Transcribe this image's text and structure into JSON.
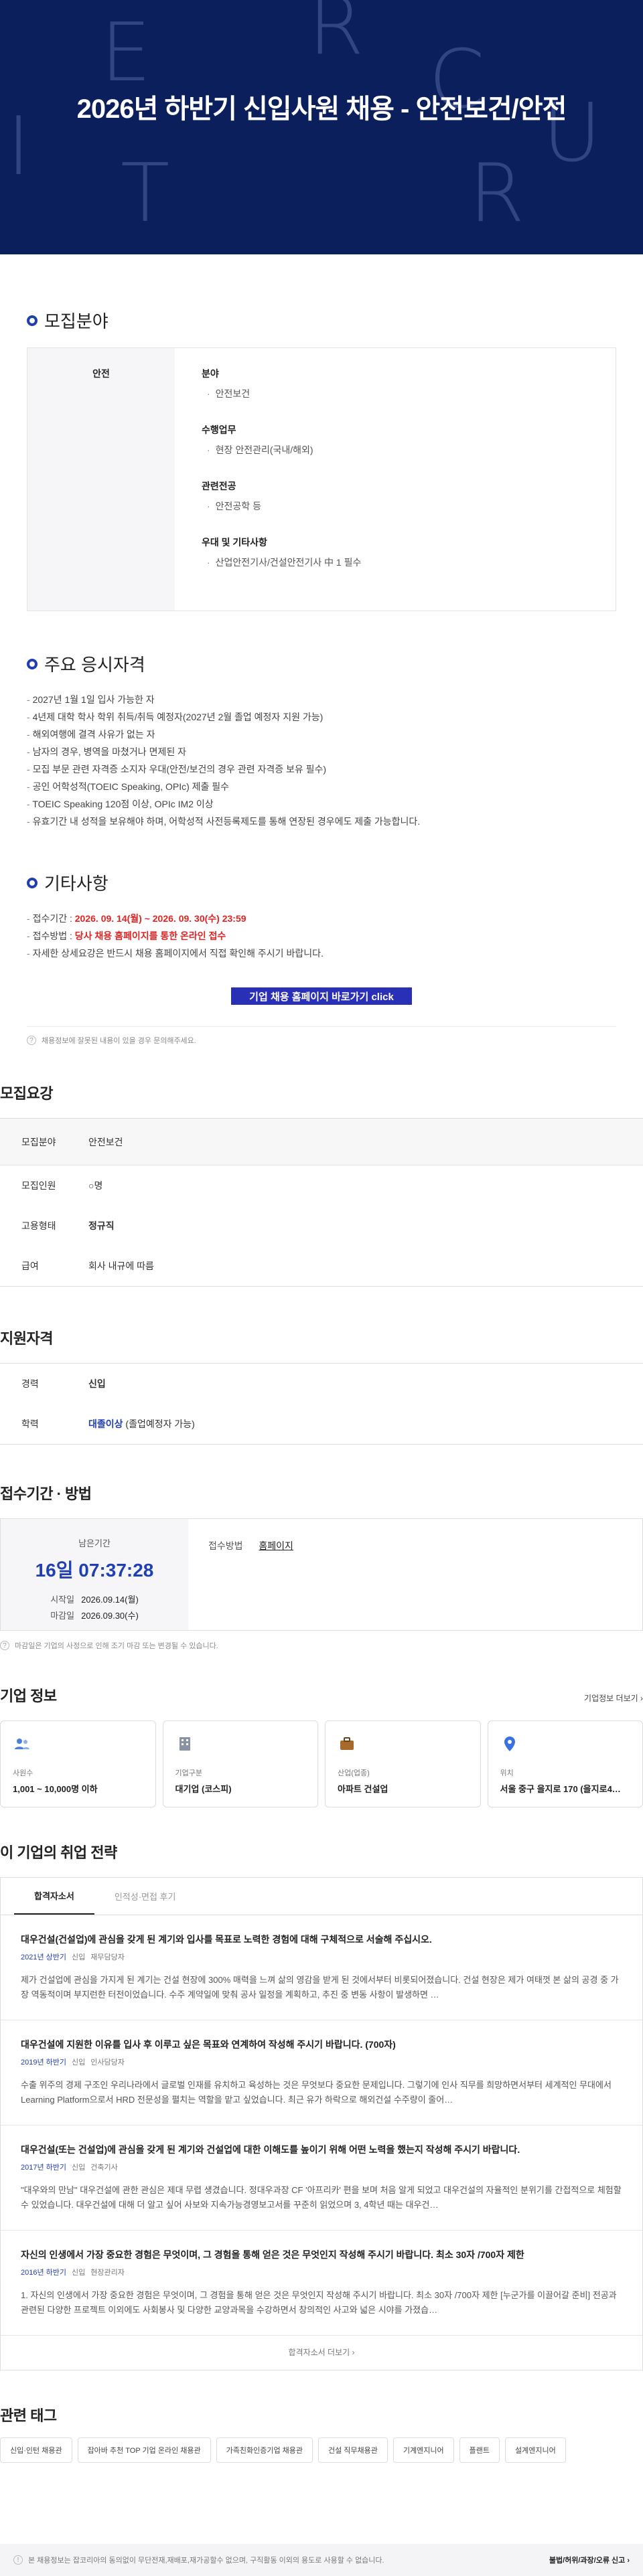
{
  "hero": {
    "title": "2026년 하반기 신입사원 채용 - 안전보건/안전",
    "deco_letters": [
      "R",
      "E",
      "C",
      "U",
      "I",
      "T",
      "R"
    ]
  },
  "recruit_field": {
    "heading": "모집분야",
    "category": "안전",
    "blocks": [
      {
        "title": "분야",
        "value": "안전보건"
      },
      {
        "title": "수행업무",
        "value": "현장 안전관리(국내/해외)"
      },
      {
        "title": "관련전공",
        "value": "안전공학 등"
      },
      {
        "title": "우대 및 기타사항",
        "value": "산업안전기사/건설안전기사 中 1 필수"
      }
    ]
  },
  "qualifications": {
    "heading": "주요 응시자격",
    "items": [
      "2027년 1월 1일 입사 가능한 자",
      "4년제 대학 학사 학위 취득/취득 예정자(2027년 2월 졸업 예정자 지원 가능)",
      "해외여행에 결격 사유가 없는 자",
      "남자의 경우, 병역을 마쳤거나 면제된 자",
      "모집 부문 관련 자격증 소지자 우대(안전/보건의 경우 관련 자격증 보유 필수)",
      "공인 어학성적(TOEIC Speaking, OPIc) 제출 필수",
      "TOEIC Speaking 120점 이상, OPIc IM2 이상",
      "유효기간 내 성적을 보유해야 하며, 어학성적 사전등록제도를 통해 연장된 경우에도 제출 가능합니다."
    ]
  },
  "etc": {
    "heading": "기타사항",
    "period_label": "접수기간 : ",
    "period_value": "2026. 09. 14(월) ~ 2026. 09. 30(수) 23:59",
    "method_label": "접수방법 : ",
    "method_value": "당사 채용 홈페이지를 통한 온라인 접수",
    "detail": "자세한 상세요강은 반드시 채용 홈페이지에서 직접 확인해 주시기 바랍니다.",
    "cta": "기업 채용 홈페이지 바로가기 click"
  },
  "notice1": "채용정보에 잘못된 내용이 있을 경우 문의해주세요.",
  "summary": {
    "heading": "모집요강",
    "rows": [
      {
        "k": "모집분야",
        "v": "안전보건"
      },
      {
        "k": "모집인원",
        "v": "○명"
      },
      {
        "k": "고용형태",
        "v": "정규직"
      },
      {
        "k": "급여",
        "v": "회사 내규에 따름"
      }
    ]
  },
  "eligibility": {
    "heading": "지원자격",
    "career_label": "경력",
    "career_value": "신입",
    "edu_label": "학력",
    "edu_value": "대졸이상",
    "edu_note": " (졸업예정자 가능)"
  },
  "apply": {
    "heading": "접수기간 · 방법",
    "remain_label": "남은기간",
    "remain_time": "16일 07:37:28",
    "start_label": "시작일",
    "start_value": "2026.09.14(월)",
    "end_label": "마감일",
    "end_value": "2026.09.30(수)",
    "method_label": "접수방법",
    "method_value": "홈페이지",
    "notice": "마감일은 기업의 사정으로 인해 조기 마감 또는 변경될 수 있습니다."
  },
  "company": {
    "heading": "기업 정보",
    "more": "기업정보 더보기 ›",
    "cards": [
      {
        "label": "사원수",
        "value": "1,001 ~ 10,000명 이하",
        "icon": "people-icon",
        "color": "#4a7fe0"
      },
      {
        "label": "기업구분",
        "value": "대기업 (코스피)",
        "icon": "building-icon",
        "color": "#8a93a6"
      },
      {
        "label": "산업(업종)",
        "value": "아파트 건설업",
        "icon": "briefcase-icon",
        "color": "#a86a2b"
      },
      {
        "label": "위치",
        "value": "서울 중구 을지로 170 (을지로4…",
        "icon": "pin-icon",
        "color": "#3a72e0"
      }
    ]
  },
  "strategy": {
    "heading": "이 기업의 취업 전략",
    "tabs": [
      "합격자소서",
      "인적성·면접 후기"
    ],
    "items": [
      {
        "q": "대우건설(건설업)에 관심을 갖게 된 계기와 입사를 목표로 노력한 경험에 대해 구체적으로 서술해 주십시오.",
        "year": "2021년 상반기",
        "type": "신입",
        "job": "재무담당자",
        "a": "제가 건설업에 관심을 가지게 된 계기는 건설 현장에 300% 매력을 느껴 삶의 영감을 받게 된 것에서부터 비롯되어졌습니다. 건설 현장은 제가 여태껏 본 삶의 공경 중 가장 역동적이며 부지런한 터전이었습니다. 수주 계약일에 맞춰 공사 일정을 계획하고, 추진 중 변동 사항이 발생하면 …"
      },
      {
        "q": "대우건설에 지원한 이유를 입사 후 이루고 싶은 목표와 연계하여 작성해 주시기 바랍니다. (700자)",
        "year": "2019년 하반기",
        "type": "신입",
        "job": "인사담당자",
        "a": "수출 위주의 경제 구조인 우리나라에서 글로벌 인재를 유치하고 육성하는 것은 무엇보다 중요한 문제입니다. 그렇기에 인사 직무를 희망하면서부터 세계적인 무대에서 Learning Platform으로서 HRD 전문성을 펼치는 역할을 맡고 싶었습니다. 최근 유가 하락으로 해외건설 수주량이 줄어…"
      },
      {
        "q": "대우건설(또는 건설업)에 관심을 갖게 된 계기와 건설업에 대한 이해도를 높이기 위해 어떤 노력을 했는지 작성해 주시기 바랍니다.",
        "year": "2017년 하반기",
        "type": "신입",
        "job": "건축기사",
        "a": "\"대우와의 만남\" 대우건설에 관한 관심은 제대 무렵 생겼습니다. 정대우과장 CF '아프리카' 편을 보며 처음 알게 되었고 대우건설의 자율적인 분위기를 간접적으로 체험할 수 있었습니다. 대우건설에 대해 더 알고 싶어 사보와 지속가능경영보고서를 꾸준히 읽었으며 3, 4학년 때는 대우건…"
      },
      {
        "q": "자신의 인생에서 가장 중요한 경험은 무엇이며, 그 경험을 통해 얻은 것은 무엇인지 작성해 주시기 바랍니다. 최소 30자 /700자 제한",
        "year": "2016년 하반기",
        "type": "신입",
        "job": "현장관리자",
        "a": "1. 자신의 인생에서 가장 중요한 경험은 무엇이며, 그 경험을 통해 얻은 것은 무엇인지 작성해 주시기 바랍니다. 최소 30자 /700자 제한 [누군가를 이끌어갈 준비] 전공과 관련된 다양한 프로젝트 이외에도 사회봉사 및 다양한 교양과목을 수강하면서 창의적인 사고와 넓은 시야를 가졌습…"
      }
    ],
    "more": "합격자소서 더보기 ›"
  },
  "tags": {
    "heading": "관련 태그",
    "items": [
      "신입·인턴 채용관",
      "잡아바 추천 TOP 기업 온라인 채용관",
      "가족친화인증기업 채용관",
      "건설 직무채용관",
      "기계엔지니어",
      "플랜트",
      "설계엔지니어"
    ]
  },
  "footer": {
    "text": "본 채용정보는 잡코리아의 동의없이 무단전재,재배포,재가공할수 없으며, 구직활동 이외의 용도로 사용할 수 없습니다.",
    "report": "불법/허위/과장/오류 신고 ›"
  }
}
